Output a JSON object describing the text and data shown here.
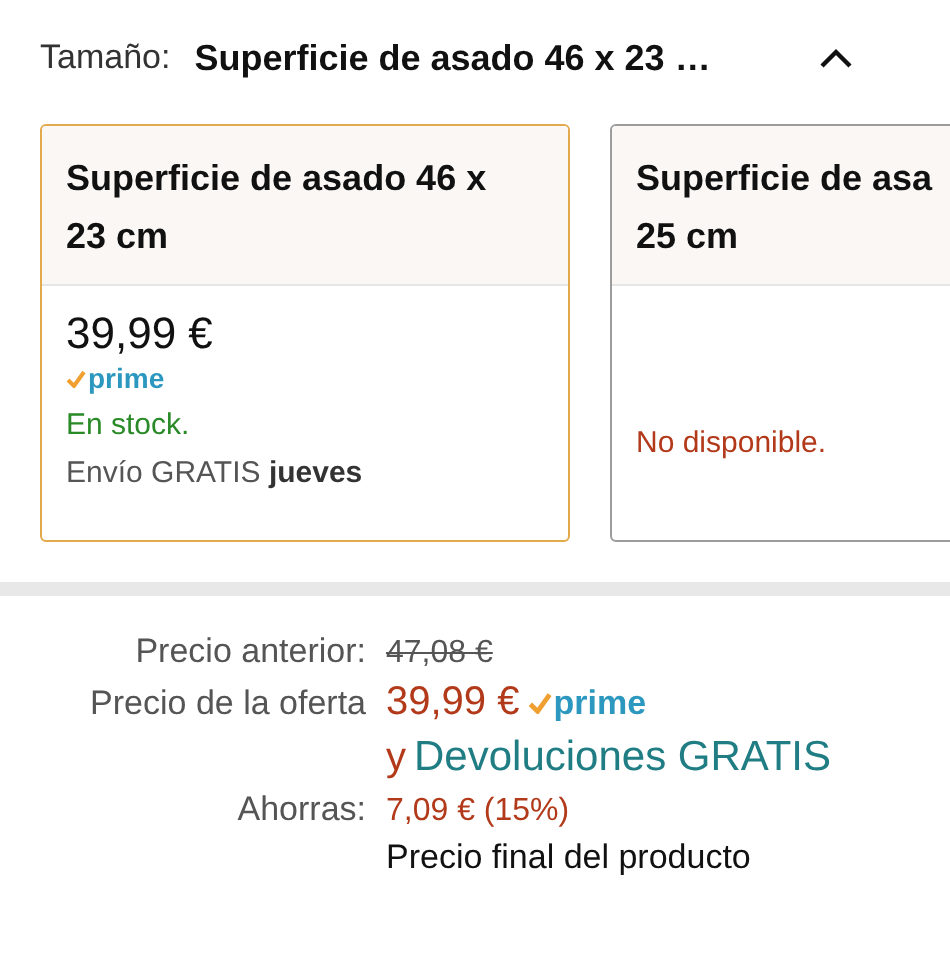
{
  "size_selector": {
    "label": "Tamaño:",
    "value": "Superficie de asado 46 x 23 …",
    "expanded": true
  },
  "variants": [
    {
      "title_lines": [
        "Superficie de asado 46 x",
        "23 cm"
      ],
      "selected": true,
      "price": "39,99 €",
      "prime": "prime",
      "availability": {
        "kind": "in_stock",
        "text": "En stock."
      },
      "delivery": {
        "text": "Envío GRATIS",
        "day": "jueves"
      }
    },
    {
      "title_lines": [
        "Superficie de asa",
        "25 cm"
      ],
      "selected": false,
      "availability": {
        "kind": "unavailable",
        "text": "No disponible."
      }
    }
  ],
  "pricing": {
    "previous": {
      "label": "Precio anterior:",
      "value": "47,08 €"
    },
    "offer": {
      "label": "Precio de la oferta",
      "value": "39,99 €",
      "prime": "prime",
      "returns_prefix": "y",
      "returns": "Devoluciones GRATIS"
    },
    "savings": {
      "label": "Ahorras:",
      "value": "7,09 € (15%)"
    },
    "note": "Precio final del producto"
  }
}
